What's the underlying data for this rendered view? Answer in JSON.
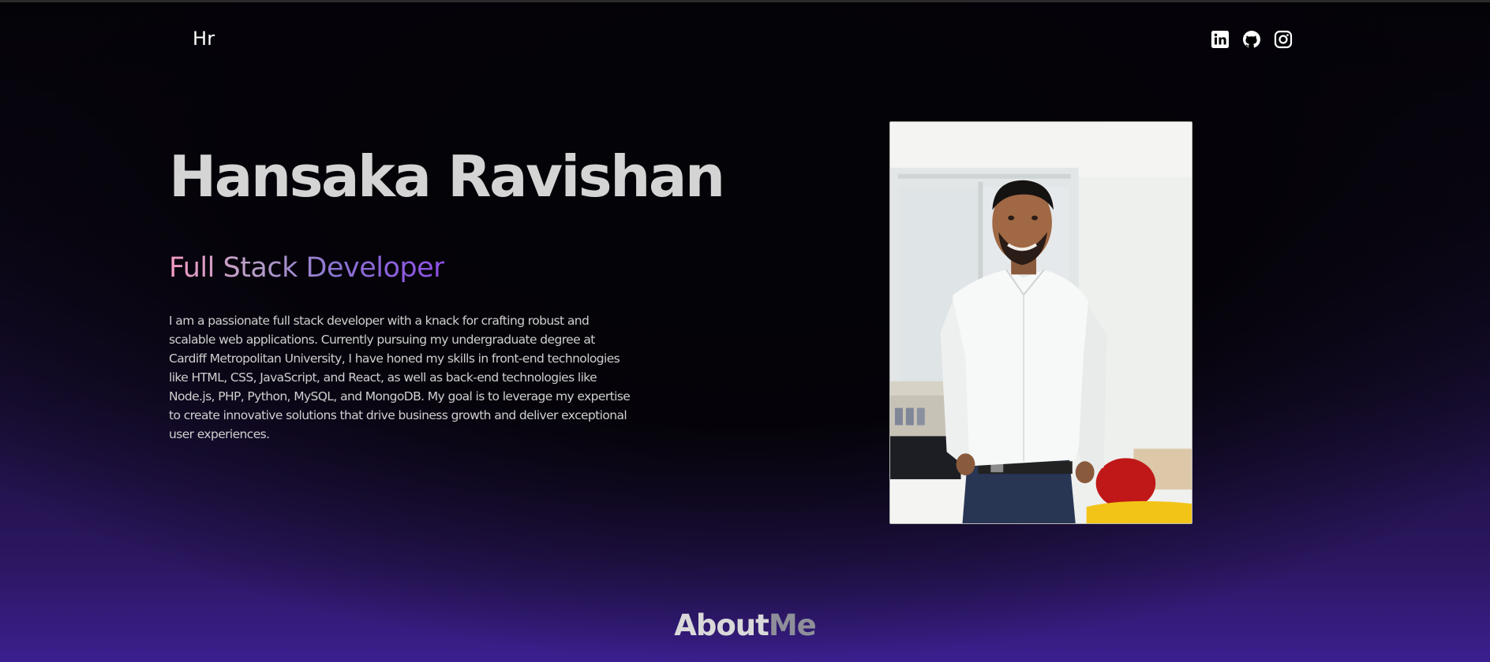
{
  "header": {
    "logo": "Hr",
    "socials": [
      {
        "icon": "linkedin-icon"
      },
      {
        "icon": "github-icon"
      },
      {
        "icon": "instagram-icon"
      }
    ]
  },
  "hero": {
    "name": "Hansaka Ravishan",
    "role": "Full Stack Developer",
    "bio": "I am a passionate full stack developer with a knack for crafting robust and scalable web applications. Currently pursuing my undergraduate degree at Cardiff Metropolitan University, I have honed my skills in front-end technologies like HTML, CSS, JavaScript, and React, as well as back-end technologies like Node.js, PHP, Python, MySQL, and MongoDB. My goal is to leverage my expertise to create innovative solutions that drive business growth and deliver exceptional user experiences."
  },
  "about": {
    "title_part1": "About",
    "title_part2": "Me"
  },
  "colors": {
    "background_top": "#040307",
    "background_bottom": "#3b1f8e",
    "name_text": "#d4d4d4",
    "role_gradient_start": "#f29ac3",
    "role_gradient_end": "#8f4fe6"
  }
}
